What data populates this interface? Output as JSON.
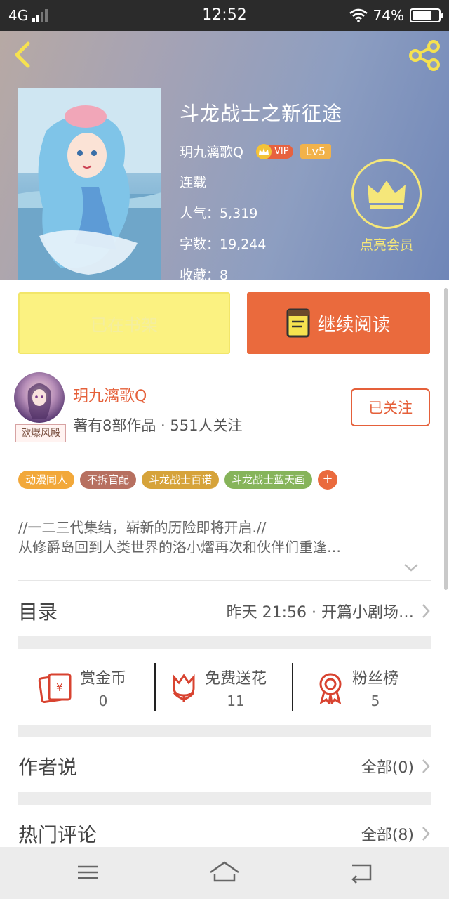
{
  "status_bar": {
    "network": "4G",
    "time": "12:52",
    "battery": "74%",
    "battery_level": 0.74
  },
  "book": {
    "title": "斗龙战士之新征途",
    "author": "玥九漓歌Q",
    "vip_label": "VIP",
    "level": "Lv5",
    "status": "连载",
    "popularity": "人气：5,319",
    "word_count": "字数：19,244",
    "favorites": "收藏：8"
  },
  "member": {
    "label": "点亮会员"
  },
  "actions": {
    "shelf_label": "已在书架",
    "read_label": "继续阅读"
  },
  "author_card": {
    "name": "玥九漓歌Q",
    "meta": "著有8部作品 · 551人关注",
    "avatar_tag": "欧爆风殿",
    "follow_label": "已关注"
  },
  "tags": [
    {
      "label": "动漫同人",
      "color": "#f2a83a"
    },
    {
      "label": "不拆官配",
      "color": "#b77060"
    },
    {
      "label": "斗龙战士百诺",
      "color": "#d6a33a"
    },
    {
      "label": "斗龙战士蓝天画",
      "color": "#86b45a"
    }
  ],
  "tag_more": "+",
  "synopsis": [
    "//一二三代集结，崭新的历险即将开启.//",
    "从修爵岛回到人类世界的洛小熠再次和伙伴们重逢…"
  ],
  "catalog": {
    "title": "目录",
    "latest": "昨天 21:56 · 开篇小剧场…"
  },
  "rewards": [
    {
      "label": "赏金币",
      "value": "0",
      "icon": "red-envelope-icon"
    },
    {
      "label": "免费送花",
      "value": "11",
      "icon": "flower-icon"
    },
    {
      "label": "粉丝榜",
      "value": "5",
      "icon": "medal-icon"
    }
  ],
  "author_says": {
    "title": "作者说",
    "link": "全部(0)"
  },
  "hot_comments": {
    "title": "热门评论",
    "link": "全部(8)"
  },
  "colors": {
    "accent": "#ea6a3d",
    "shelf_button": "#fbf281",
    "member_gold": "#f5e77a"
  }
}
